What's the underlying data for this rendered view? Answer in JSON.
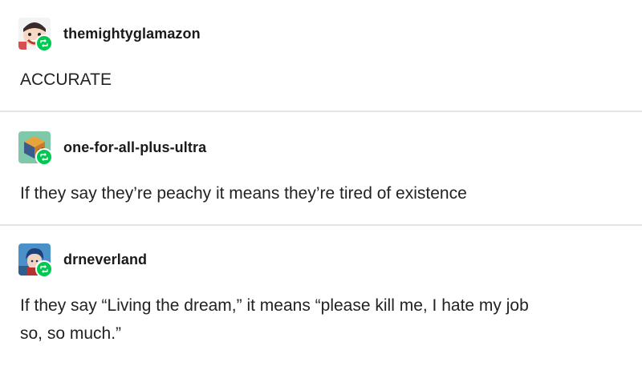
{
  "posts": [
    {
      "username": "themightyglamazon",
      "avatar_icon": "cartoon-face-avatar-icon",
      "badge_icon": "reblog-icon",
      "text": "ACCURATE"
    },
    {
      "username": "one-for-all-plus-ultra",
      "avatar_icon": "cube-avatar-icon",
      "badge_icon": "reblog-icon",
      "text": "If they say they’re peachy it means they’re tired of existence"
    },
    {
      "username": "drneverland",
      "avatar_icon": "anime-character-avatar-icon",
      "badge_icon": "reblog-icon",
      "text_line1": "If they say “Living the dream,” it means “please kill me, I hate my job",
      "text_line2": "so, so much.”"
    }
  ],
  "colors": {
    "reblog_badge": "#00c853",
    "divider": "#e4e4e4",
    "text": "#222222"
  }
}
